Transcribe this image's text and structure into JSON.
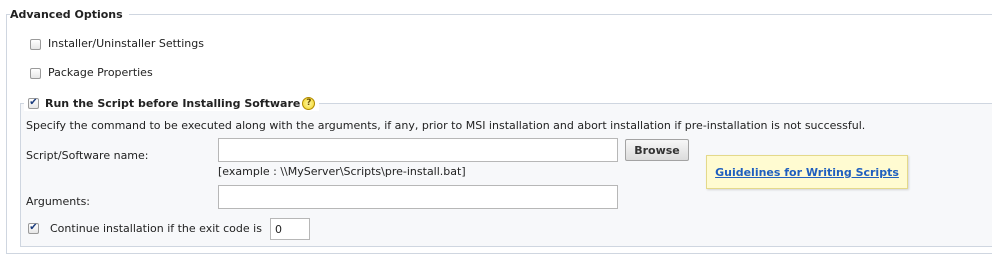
{
  "section": {
    "title": "Advanced Options"
  },
  "options": {
    "installer_settings": {
      "label": "Installer/Uninstaller Settings",
      "checked": false
    },
    "package_properties": {
      "label": "Package Properties",
      "checked": false
    },
    "pre_install_script": {
      "label": "Run the Script before Installing Software",
      "checked": true,
      "help_icon": "question-icon"
    }
  },
  "script_panel": {
    "description": "Specify the command to be executed along with the arguments, if any, prior to MSI installation and abort installation if pre-installation is not successful.",
    "script_label": "Script/Software name:",
    "script_value": "",
    "browse_label": "Browse",
    "example_text": "[example : \\\\MyServer\\Scripts\\pre-install.bat]",
    "guidelines_link": "Guidelines for Writing Scripts",
    "arguments_label": "Arguments:",
    "arguments_value": "",
    "continue_label": "Continue installation if the exit code is",
    "continue_checked": true,
    "exit_code_value": "0"
  },
  "colors": {
    "frame_border": "#cfd6e0",
    "link": "#1f5fbf",
    "guide_bg": "#fffbd1",
    "help_icon": "#f2d21b"
  }
}
